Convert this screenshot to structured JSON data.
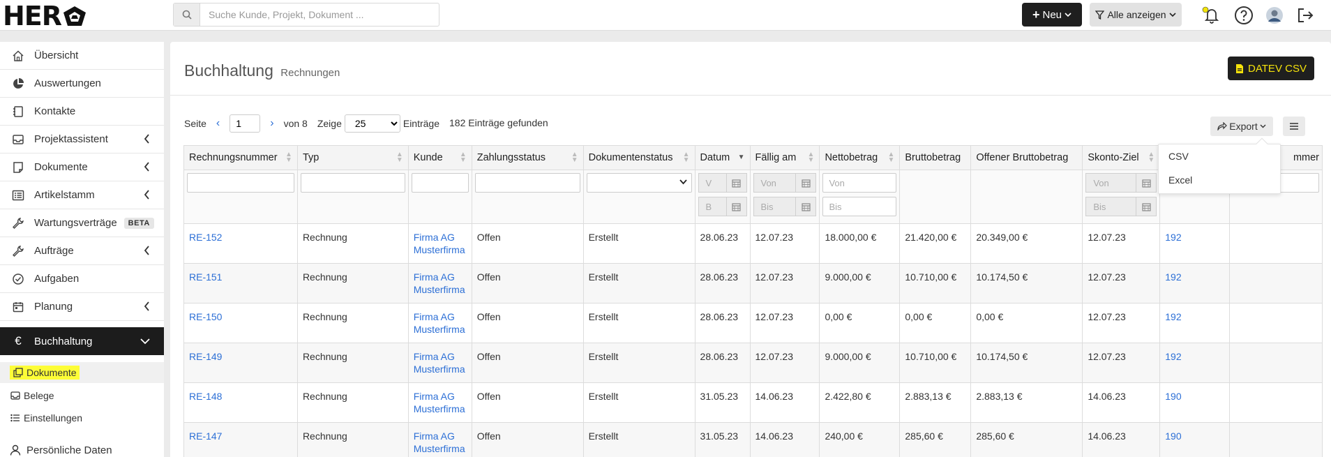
{
  "brand": {
    "logo_text": "HER"
  },
  "search": {
    "placeholder": "Suche Kunde, Projekt, Dokument ..."
  },
  "topbar": {
    "new_label": "Neu",
    "filter_label": "Alle anzeigen"
  },
  "sidebar": {
    "items": [
      {
        "label": "Übersicht"
      },
      {
        "label": "Auswertungen"
      },
      {
        "label": "Kontakte"
      },
      {
        "label": "Projektassistent"
      },
      {
        "label": "Dokumente"
      },
      {
        "label": "Artikelstamm"
      },
      {
        "label": "Wartungsverträge",
        "badge": "BETA"
      },
      {
        "label": "Aufträge"
      },
      {
        "label": "Aufgaben"
      },
      {
        "label": "Planung"
      },
      {
        "label": "Buchhaltung"
      }
    ],
    "subitems": [
      {
        "label": "Dokumente"
      },
      {
        "label": "Belege"
      },
      {
        "label": "Einstellungen"
      },
      {
        "label": "Persönliche Daten"
      }
    ]
  },
  "page": {
    "title": "Buchhaltung",
    "subtitle": "Rechnungen",
    "datev_label": "DATEV CSV"
  },
  "pager": {
    "page_label": "Seite",
    "page_value": "1",
    "of_label": "von 8",
    "show_label": "Zeige",
    "per_page": "25",
    "entries_label": "Einträge",
    "found_label": "182 Einträge gefunden"
  },
  "export": {
    "label": "Export",
    "options": [
      "CSV",
      "Excel"
    ]
  },
  "table": {
    "headers": [
      "Rechnungsnummer",
      "Typ",
      "Kunde",
      "Zahlungsstatus",
      "Dokumentenstatus",
      "Datum",
      "Fällig am",
      "Nettobetrag",
      "Bruttobetrag",
      "Offener Bruttobetrag",
      "Skonto-Ziel",
      "",
      "mmer"
    ],
    "filters": {
      "von": "Von",
      "bis": "Bis",
      "v": "V",
      "b": "B"
    },
    "rows": [
      {
        "nummer": "RE-152",
        "typ": "Rechnung",
        "kunde1": "Firma AG",
        "kunde2": "Musterfirma",
        "zahlung": "Offen",
        "dokstatus": "Erstellt",
        "datum": "28.06.23",
        "faellig": "12.07.23",
        "netto": "18.000,00 €",
        "brutto": "21.420,00 €",
        "offen": "20.349,00 €",
        "skonto": "12.07.23",
        "extra": "192"
      },
      {
        "nummer": "RE-151",
        "typ": "Rechnung",
        "kunde1": "Firma AG",
        "kunde2": "Musterfirma",
        "zahlung": "Offen",
        "dokstatus": "Erstellt",
        "datum": "28.06.23",
        "faellig": "12.07.23",
        "netto": "9.000,00 €",
        "brutto": "10.710,00 €",
        "offen": "10.174,50 €",
        "skonto": "12.07.23",
        "extra": "192"
      },
      {
        "nummer": "RE-150",
        "typ": "Rechnung",
        "kunde1": "Firma AG",
        "kunde2": "Musterfirma",
        "zahlung": "Offen",
        "dokstatus": "Erstellt",
        "datum": "28.06.23",
        "faellig": "12.07.23",
        "netto": "0,00 €",
        "brutto": "0,00 €",
        "offen": "0,00 €",
        "skonto": "12.07.23",
        "extra": "192"
      },
      {
        "nummer": "RE-149",
        "typ": "Rechnung",
        "kunde1": "Firma AG",
        "kunde2": "Musterfirma",
        "zahlung": "Offen",
        "dokstatus": "Erstellt",
        "datum": "28.06.23",
        "faellig": "12.07.23",
        "netto": "9.000,00 €",
        "brutto": "10.710,00 €",
        "offen": "10.174,50 €",
        "skonto": "12.07.23",
        "extra": "192"
      },
      {
        "nummer": "RE-148",
        "typ": "Rechnung",
        "kunde1": "Firma AG",
        "kunde2": "Musterfirma",
        "zahlung": "Offen",
        "dokstatus": "Erstellt",
        "datum": "31.05.23",
        "faellig": "14.06.23",
        "netto": "2.422,80 €",
        "brutto": "2.883,13 €",
        "offen": "2.883,13 €",
        "skonto": "14.06.23",
        "extra": "190"
      },
      {
        "nummer": "RE-147",
        "typ": "Rechnung",
        "kunde1": "Firma AG",
        "kunde2": "Musterfirma",
        "zahlung": "Offen",
        "dokstatus": "Erstellt",
        "datum": "31.05.23",
        "faellig": "14.06.23",
        "netto": "240,00 €",
        "brutto": "285,60 €",
        "offen": "285,60 €",
        "skonto": "14.06.23",
        "extra": "190"
      }
    ]
  },
  "colors": {
    "accent_link": "#2c6fd6",
    "dark": "#1f1f1f",
    "highlight": "#fdfd37",
    "datev_text": "#f5e20b"
  }
}
